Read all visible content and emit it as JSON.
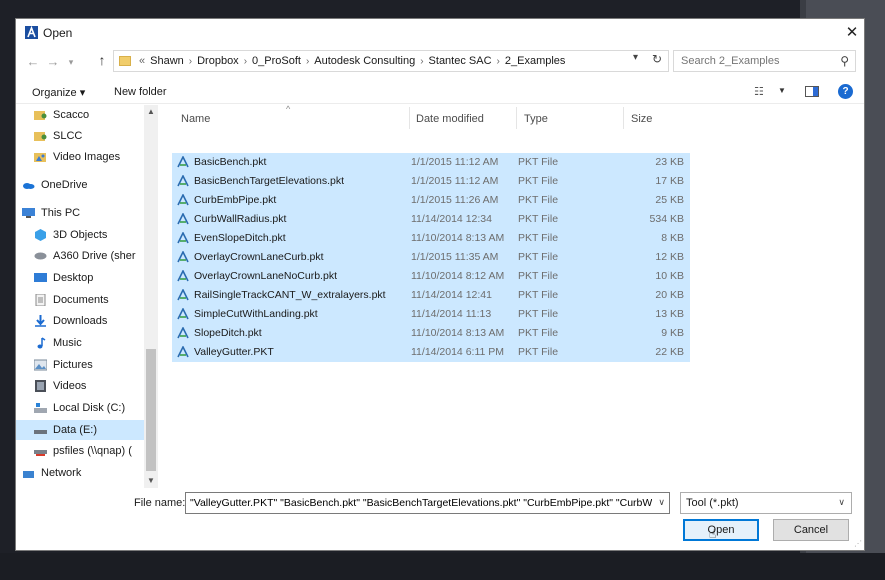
{
  "dialog": {
    "title": "Open",
    "close_label": "✕"
  },
  "address": {
    "overflow": "«",
    "crumbs": [
      "Shawn",
      "Dropbox",
      "0_ProSoft",
      "Autodesk Consulting",
      "Stantec SAC",
      "2_Examples"
    ]
  },
  "search": {
    "placeholder": "Search 2_Examples"
  },
  "toolbar": {
    "organize_label": "Organize ▾",
    "new_folder_label": "New folder"
  },
  "navpane": {
    "items": [
      {
        "label": "Scacco",
        "icon": "user-folder-icon"
      },
      {
        "label": "SLCC",
        "icon": "user-folder-icon"
      },
      {
        "label": "Video Images",
        "icon": "image-folder-icon"
      },
      {
        "label": "OneDrive",
        "icon": "onedrive-icon"
      },
      {
        "label": "This PC",
        "icon": "computer-icon"
      },
      {
        "label": "3D Objects",
        "icon": "objects3d-icon"
      },
      {
        "label": "A360 Drive (sher",
        "icon": "a360-drive-icon"
      },
      {
        "label": "Desktop",
        "icon": "desktop-icon"
      },
      {
        "label": "Documents",
        "icon": "documents-icon"
      },
      {
        "label": "Downloads",
        "icon": "downloads-icon"
      },
      {
        "label": "Music",
        "icon": "music-icon"
      },
      {
        "label": "Pictures",
        "icon": "pictures-icon"
      },
      {
        "label": "Videos",
        "icon": "videos-icon"
      },
      {
        "label": "Local Disk (C:)",
        "icon": "local-disk-icon"
      },
      {
        "label": "Data (E:)",
        "icon": "data-drive-icon",
        "selected": true
      },
      {
        "label": "psfiles (\\\\qnap) (",
        "icon": "network-drive-icon"
      },
      {
        "label": "Network",
        "icon": "network-icon"
      }
    ]
  },
  "filelist": {
    "columns": [
      "Name",
      "Date modified",
      "Type",
      "Size"
    ],
    "rows": [
      {
        "name": "BasicBench.pkt",
        "date": "1/1/2015 11:12 AM",
        "type": "PKT File",
        "size": "23 KB"
      },
      {
        "name": "BasicBenchTargetElevations.pkt",
        "date": "1/1/2015 11:12 AM",
        "type": "PKT File",
        "size": "17 KB"
      },
      {
        "name": "CurbEmbPipe.pkt",
        "date": "1/1/2015 11:26 AM",
        "type": "PKT File",
        "size": "25 KB"
      },
      {
        "name": "CurbWallRadius.pkt",
        "date": "11/14/2014 12:34",
        "type": "PKT File",
        "size": "534 KB"
      },
      {
        "name": "EvenSlopeDitch.pkt",
        "date": "11/10/2014 8:13 AM",
        "type": "PKT File",
        "size": "8 KB"
      },
      {
        "name": "OverlayCrownLaneCurb.pkt",
        "date": "1/1/2015 11:35 AM",
        "type": "PKT File",
        "size": "12 KB"
      },
      {
        "name": "OverlayCrownLaneNoCurb.pkt",
        "date": "11/10/2014 8:12 AM",
        "type": "PKT File",
        "size": "10 KB"
      },
      {
        "name": "RailSingleTrackCANT_W_extralayers.pkt",
        "date": "11/14/2014 12:41",
        "type": "PKT File",
        "size": "20 KB"
      },
      {
        "name": "SimpleCutWithLanding.pkt",
        "date": "11/14/2014 11:13",
        "type": "PKT File",
        "size": "13 KB"
      },
      {
        "name": "SlopeDitch.pkt",
        "date": "11/10/2014 8:13 AM",
        "type": "PKT File",
        "size": "9 KB"
      },
      {
        "name": "ValleyGutter.PKT",
        "date": "11/14/2014 6:11 PM",
        "type": "PKT File",
        "size": "22 KB"
      }
    ]
  },
  "footer": {
    "filename_label": "File name:",
    "filename_value": "\"ValleyGutter.PKT\" \"BasicBench.pkt\" \"BasicBenchTargetElevations.pkt\" \"CurbEmbPipe.pkt\" \"CurbW",
    "filetype_value": "Tool (*.pkt)",
    "open_label": "Open",
    "cancel_label": "Cancel"
  },
  "colors": {
    "selection": "#cce8ff",
    "accent": "#0078d7"
  }
}
